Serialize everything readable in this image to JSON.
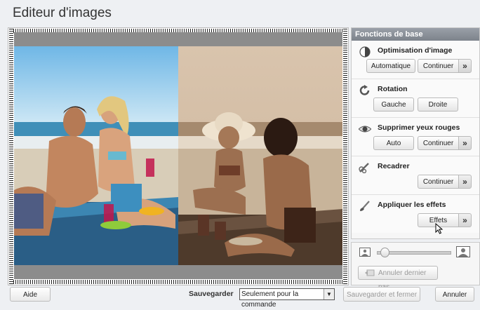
{
  "app": {
    "title": "Editeur d'images"
  },
  "panel": {
    "header": "Fonctions de base",
    "sections": [
      {
        "title": "Optimisation d'image",
        "icon": "contrast-icon",
        "buttons": [
          "Automatique",
          "Continuer"
        ],
        "arrow": "»"
      },
      {
        "title": "Rotation",
        "icon": "rotate-icon",
        "buttons": [
          "Gauche",
          "Droite"
        ]
      },
      {
        "title": "Supprimer yeux rouges",
        "icon": "eye-icon",
        "buttons": [
          "Auto",
          "Continuer"
        ],
        "arrow": "»"
      },
      {
        "title": "Recadrer",
        "icon": "crop-icon",
        "buttons": [
          "Continuer"
        ],
        "arrow": "»"
      },
      {
        "title": "Appliquer les effets",
        "icon": "brush-icon",
        "buttons": [
          "Effets"
        ],
        "arrow": "»"
      }
    ]
  },
  "zoom": {
    "undo_label": "Annuler dernier pas",
    "level": 0.05
  },
  "footer": {
    "help": "Aide",
    "save_label": "Sauvegarder",
    "save_option": "Seulement pour la commande",
    "save_close": "Sauvegarder et fermer",
    "cancel": "Annuler"
  }
}
